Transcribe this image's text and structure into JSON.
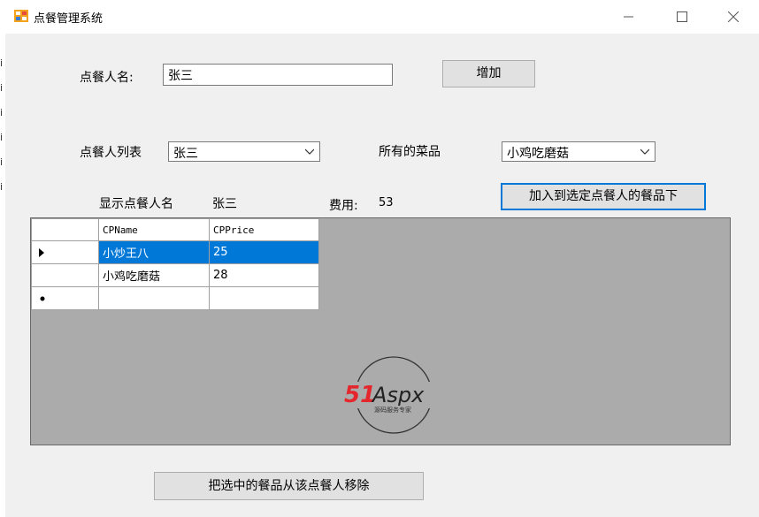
{
  "window": {
    "title": "点餐管理系统"
  },
  "form": {
    "orderer_label": "点餐人名:",
    "orderer_value": "张三",
    "add_button": "增加",
    "list_label": "点餐人列表",
    "list_selected": "张三",
    "dishes_label": "所有的菜品",
    "dish_selected": "小鸡吃磨菇",
    "show_label": "显示点餐人名",
    "show_value": "张三",
    "cost_label": "费用:",
    "cost_value": "53",
    "add_to_button": "加入到选定点餐人的餐品下",
    "remove_button": "把选中的餐品从该点餐人移除"
  },
  "grid": {
    "columns": [
      "CPName",
      "CPPrice"
    ],
    "rows": [
      {
        "name": "小炒王八",
        "price": "25"
      },
      {
        "name": "小鸡吃磨菇",
        "price": "28"
      }
    ],
    "selected_row": 0
  },
  "watermark": {
    "brand": "51Aspx",
    "tagline": "源码服务专家"
  },
  "colors": {
    "selection": "#0078d7",
    "grid_bg": "#ababab",
    "window_bg": "#f0f0f0",
    "logo_red": "#e4262d",
    "logo_green": "#2e9e3c"
  }
}
